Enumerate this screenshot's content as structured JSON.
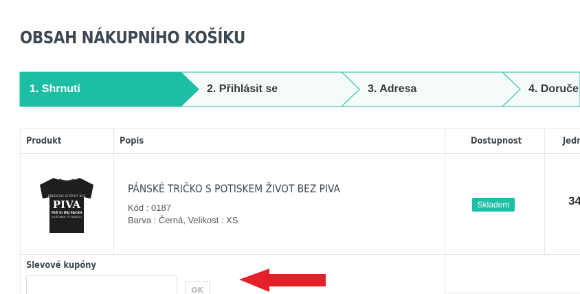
{
  "page": {
    "title": "OBSAH NÁKUPNÍHO KOŠÍKU"
  },
  "steps": [
    {
      "label": "1. Shrnutí",
      "active": true
    },
    {
      "label": "2. Přihlásit se",
      "active": false
    },
    {
      "label": "3. Adresa",
      "active": false
    },
    {
      "label": "4. Doruče",
      "active": false
    }
  ],
  "table": {
    "headers": {
      "product": "Produkt",
      "description": "Popis",
      "availability": "Dostupnost",
      "unit_price": "Jedn"
    },
    "rows": [
      {
        "name": "PÁNSKÉ TRIČKO S POTISKEM ŽIVOT BEZ PIVA",
        "code_label": "Kód :",
        "code": "0187",
        "color_label": "Barva :",
        "color": "Černá,",
        "size_label": "Velikost :",
        "size": "XS",
        "availability": "Skladem",
        "price": "34",
        "image_text": {
          "line1": "PŘEDSTAV SI ŽIVOT BEZ",
          "line2": "PIVA",
          "line3": "TEĎ SI DEJ FACKU",
          "line4": "A UŽ NIKDY TO NEDĚLEJ"
        }
      }
    ]
  },
  "coupon": {
    "title": "Slevové kupóny",
    "input_value": "",
    "button_label": "OK"
  },
  "colors": {
    "accent": "#1dbfa4",
    "arrow": "#e4202a",
    "heading": "#3d4852",
    "step_border": "#1dbfa4",
    "step_bg": "#f5fafa"
  }
}
